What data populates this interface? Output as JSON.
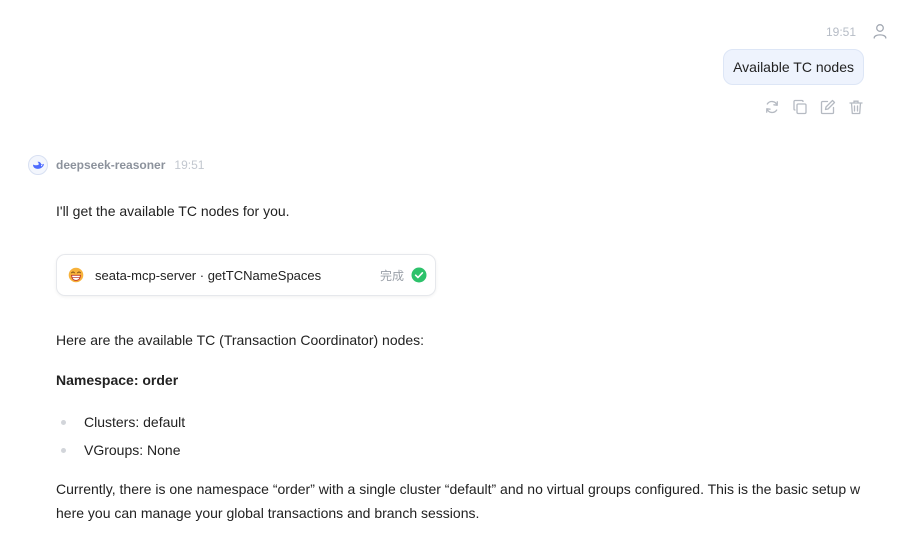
{
  "user_message": {
    "time": "19:51",
    "avatar_icon": "user-icon",
    "text": "Available TC nodes",
    "actions": [
      "refresh-icon",
      "copy-icon",
      "edit-icon",
      "delete-icon"
    ]
  },
  "assistant": {
    "model_name": "deepseek-reasoner",
    "time": "19:51",
    "intro": "I'll get the available TC nodes for you.",
    "tool_call": {
      "icon": "grin-emoji-icon",
      "name": "seata-mcp-server · getTCNameSpaces",
      "status": "完成",
      "status_icon": "check-circle-icon",
      "status_color": "#2dc26b"
    },
    "summary": "Here are the available TC (Transaction Coordinator) nodes:",
    "namespace_heading": "Namespace: order",
    "bullets": [
      "Clusters: default",
      "VGroups: None"
    ],
    "closing": "Currently, there is one namespace “order” with a single cluster “default” and no virtual groups configured. This is the basic setup where you can manage your global transactions and branch sessions."
  }
}
